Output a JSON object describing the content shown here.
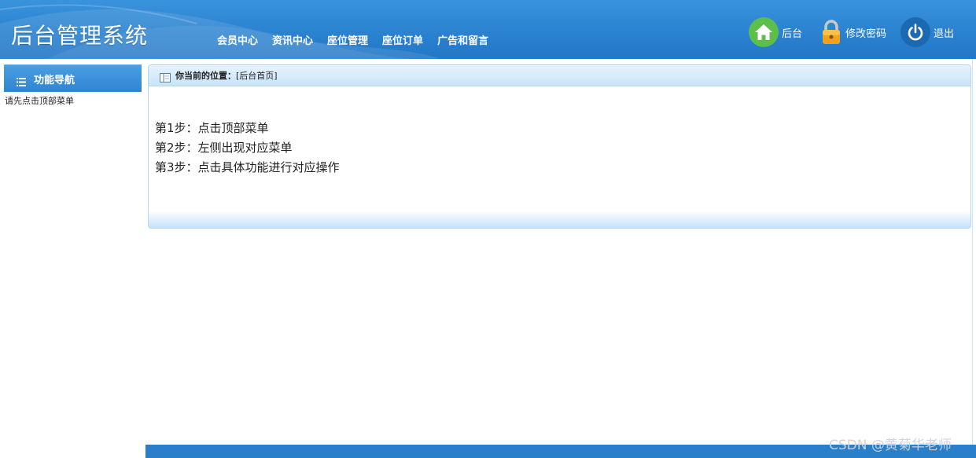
{
  "header": {
    "title": "后台管理系统",
    "nav": [
      "会员中心",
      "资讯中心",
      "座位管理",
      "座位订单",
      "广告和留言"
    ],
    "actions": {
      "home": "后台",
      "password": "修改密码",
      "logout": "退出"
    }
  },
  "sidebar": {
    "heading": "功能导航",
    "hint": "请先点击顶部菜单"
  },
  "main": {
    "breadcrumb_label": "你当前的位置：",
    "breadcrumb_value": "[后台首页]",
    "steps": [
      "第1步：点击顶部菜单",
      "第2步：左侧出现对应菜单",
      "第3步：点击具体功能进行对应操作"
    ]
  },
  "watermark": "CSDN @黄菊华老师",
  "colors": {
    "header_bg": "#2a82d0",
    "home_green": "#5bbf49",
    "lock_orange": "#f0a21d",
    "power_blue": "#1b69b1",
    "footer_bar": "#2a7fcb"
  },
  "icons": [
    "home-icon",
    "lock-icon",
    "power-icon",
    "list-icon",
    "panel-icon"
  ]
}
